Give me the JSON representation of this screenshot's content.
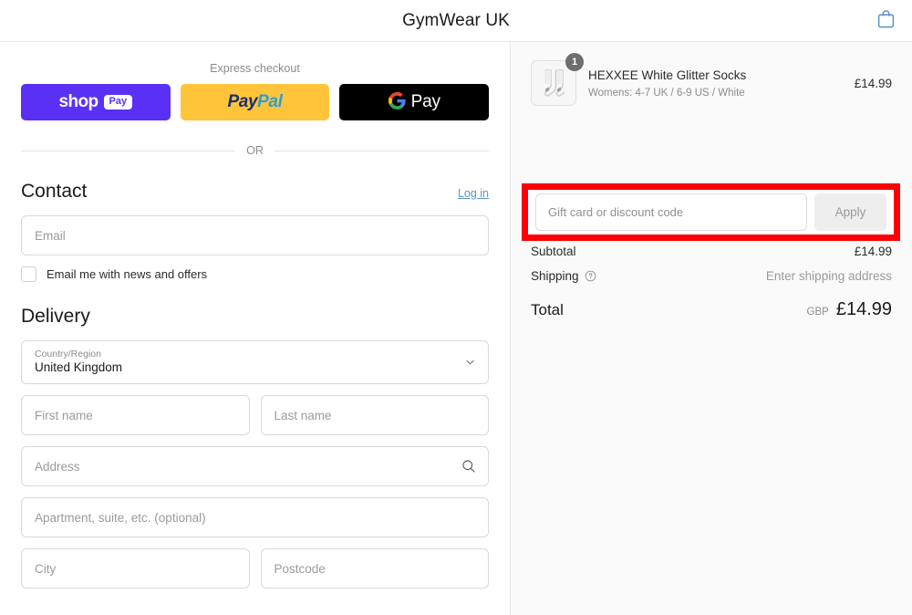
{
  "header": {
    "shop_title": "GymWear UK",
    "cart_icon": "shopping-bag-icon",
    "cart_icon_color": "#5b93c7"
  },
  "express": {
    "label": "Express checkout",
    "or_text": "OR",
    "wallets": [
      {
        "name": "shop-pay",
        "word": "shop",
        "badge": "Pay",
        "bg": "#5a31f4"
      },
      {
        "name": "paypal",
        "part1": "Pay",
        "part2": "Pal",
        "bg": "#ffc439"
      },
      {
        "name": "google-pay",
        "glyph": "G",
        "word": "Pay",
        "bg": "#000000"
      }
    ]
  },
  "contact": {
    "title": "Contact",
    "login_label": "Log in",
    "email_placeholder": "Email",
    "email_value": "",
    "newsletter_label": "Email me with news and offers",
    "newsletter_checked": false
  },
  "delivery": {
    "title": "Delivery",
    "country_label": "Country/Region",
    "country_value": "United Kingdom",
    "first_name_placeholder": "First name",
    "first_name_value": "",
    "last_name_placeholder": "Last name",
    "last_name_value": "",
    "address_placeholder": "Address",
    "address_value": "",
    "address_icon": "search-icon",
    "apartment_placeholder": "Apartment, suite, etc. (optional)",
    "apartment_value": "",
    "city_placeholder": "City",
    "city_value": "",
    "postcode_placeholder": "Postcode",
    "postcode_value": ""
  },
  "summary": {
    "item": {
      "title": "HEXXEE White Glitter Socks",
      "variant": "Womens: 4-7 UK / 6-9 US / White",
      "price": "£14.99",
      "quantity": "1",
      "image": "white-socks-thumbnail"
    },
    "discount": {
      "placeholder": "Gift card or discount code",
      "value": "",
      "apply_label": "Apply",
      "highlight_color": "#fb0007"
    },
    "subtotal_label": "Subtotal",
    "subtotal_value": "£14.99",
    "shipping_label": "Shipping",
    "shipping_help_icon": "question-circle-icon",
    "shipping_value": "Enter shipping address",
    "total_label": "Total",
    "total_currency": "GBP",
    "total_value": "£14.99"
  }
}
